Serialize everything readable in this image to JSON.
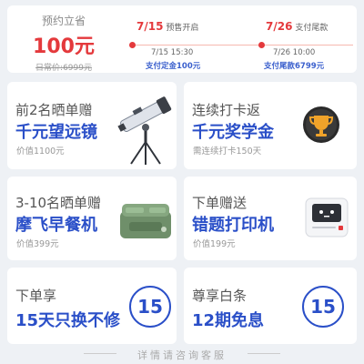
{
  "presale": {
    "save_label": "预约立省",
    "save_amount": "100元",
    "original_price": "日常价:6999元",
    "stage1": {
      "date": "7/15",
      "label": "预售开启",
      "time": "7/15  15:30",
      "pay": "支付定金100元"
    },
    "stage2": {
      "date": "7/26",
      "label": "支付尾款",
      "time": "7/26  10:00",
      "pay": "支付尾款6799元"
    }
  },
  "cards": [
    {
      "title": "前2名晒单赠",
      "headline": "千元望远镜",
      "note": "价值1100元",
      "icon": "telescope-icon"
    },
    {
      "title": "连续打卡返",
      "headline": "千元奖学金",
      "note": "需连续打卡150天",
      "icon": "trophy-icon"
    },
    {
      "title": "3-10名晒单赠",
      "headline": "摩飞早餐机",
      "note": "价值399元",
      "icon": "breakfast-machine-icon"
    },
    {
      "title": "下单赠送",
      "headline": "错题打印机",
      "note": "价值199元",
      "icon": "printer-icon"
    },
    {
      "title": "下单享",
      "headline": "15天只换不修",
      "badge": "15"
    },
    {
      "title": "尊享白条",
      "headline": "12期免息",
      "badge": "15"
    }
  ],
  "footer": "详情请咨询客服"
}
